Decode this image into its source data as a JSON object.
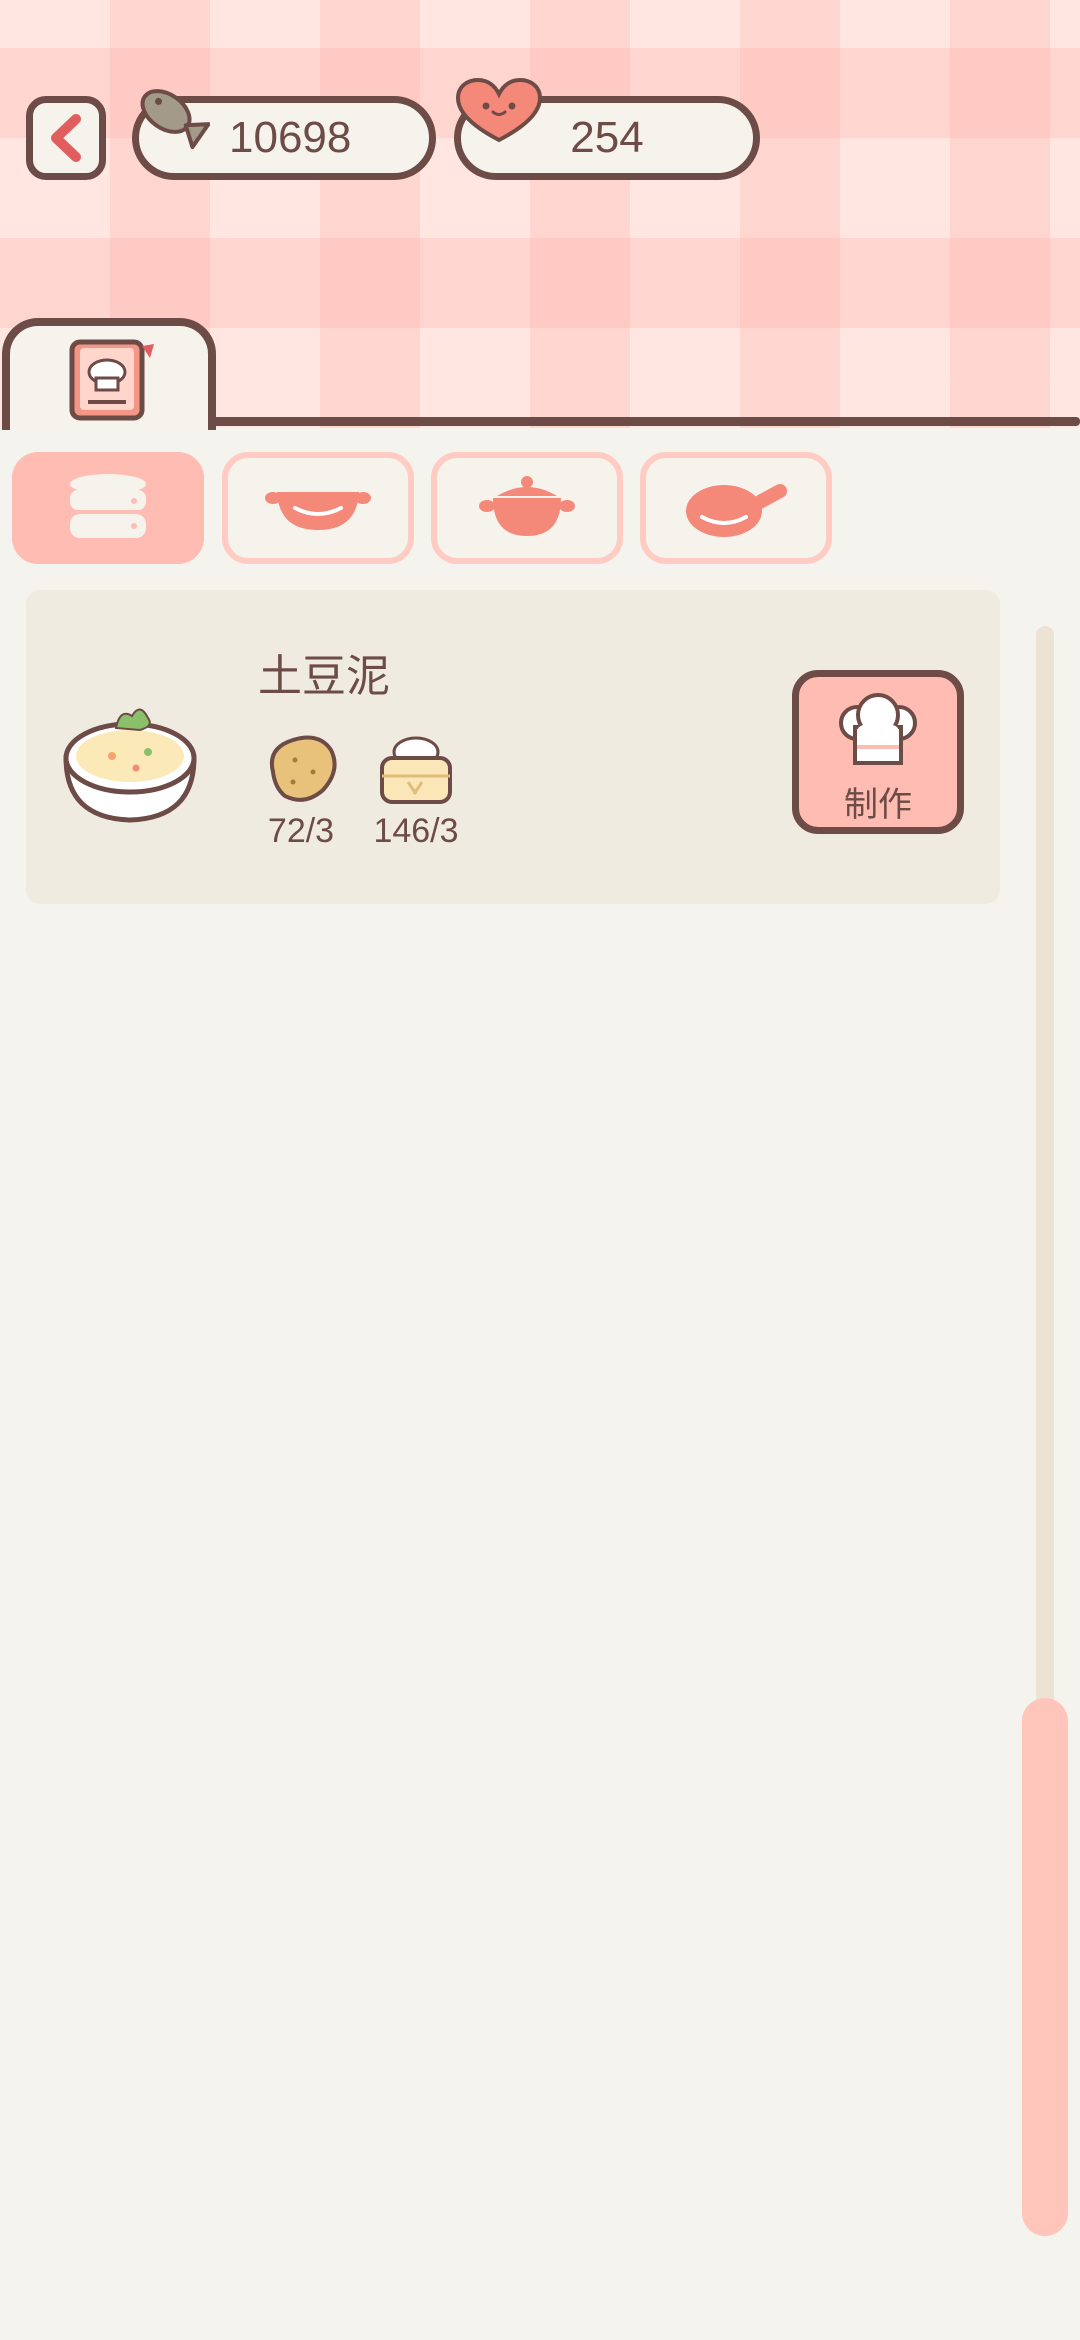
{
  "header": {
    "fish_count": "10698",
    "heart_count": "254"
  },
  "recipe_book_tab": {
    "icon": "chef-book-icon"
  },
  "categories": [
    {
      "icon": "steamer-icon",
      "active": true
    },
    {
      "icon": "wok-icon",
      "active": false
    },
    {
      "icon": "pot-icon",
      "active": false
    },
    {
      "icon": "frying-pan-icon",
      "active": false
    }
  ],
  "recipes": [
    {
      "name": "土豆泥",
      "icon": "mashed-potato-bowl-icon",
      "ingredients": [
        {
          "icon": "potato-icon",
          "count": "72/3"
        },
        {
          "icon": "rice-cake-icon",
          "count": "146/3"
        }
      ],
      "make_label": "制作"
    }
  ],
  "colors": {
    "accent": "#ffbcb2",
    "outline": "#6d4b46",
    "background": "#f5f3ee",
    "card": "#f0ebe1",
    "scroll_thumb": "#ffc5bb"
  }
}
